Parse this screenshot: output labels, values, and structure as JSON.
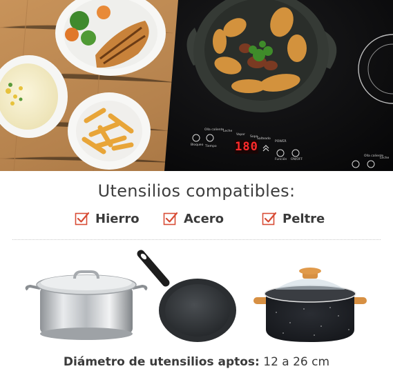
{
  "cooktop": {
    "display_value": "180",
    "labels": {
      "hot_plate": "Olla caliente",
      "milk": "Leche",
      "steam": "Vapor",
      "soup": "Sopa",
      "saute": "Salteado",
      "power": "POWER",
      "lock": "Bloqueo",
      "timer": "Tiempo",
      "function": "Función",
      "on_off": "ON/OFF"
    }
  },
  "heading": "Utensilios compatibles:",
  "materials": [
    "Hierro",
    "Acero",
    "Peltre"
  ],
  "footer": {
    "label": "Diámetro de utensilios aptos:",
    "value": "12 a 26 cm"
  },
  "colors": {
    "check_accent": "#d84c35",
    "cooktop_glass": "#0f0f10",
    "display_red": "#ff2b2b",
    "wood": "#b9854f"
  }
}
